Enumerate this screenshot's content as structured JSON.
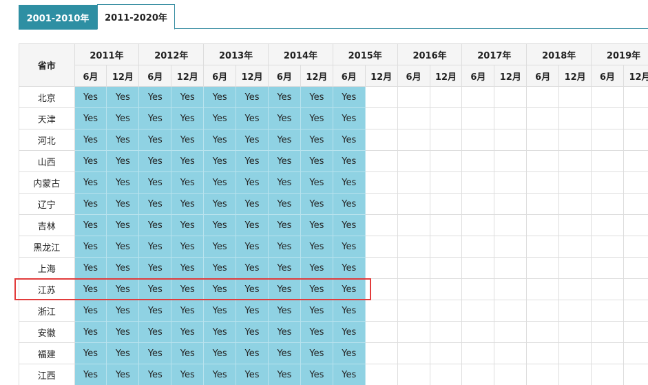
{
  "tabs": [
    "2001-2010年",
    "2011-2020年"
  ],
  "table": {
    "corner_label": "省市",
    "years": [
      "2011年",
      "2012年",
      "2013年",
      "2014年",
      "2015年",
      "2016年",
      "2017年",
      "2018年",
      "2019年"
    ],
    "months": [
      "6月",
      "12月"
    ],
    "rows": [
      {
        "province": "北京",
        "values": [
          "Yes",
          "Yes",
          "Yes",
          "Yes",
          "Yes",
          "Yes",
          "Yes",
          "Yes",
          "Yes"
        ]
      },
      {
        "province": "天津",
        "values": [
          "Yes",
          "Yes",
          "Yes",
          "Yes",
          "Yes",
          "Yes",
          "Yes",
          "Yes",
          "Yes"
        ]
      },
      {
        "province": "河北",
        "values": [
          "Yes",
          "Yes",
          "Yes",
          "Yes",
          "Yes",
          "Yes",
          "Yes",
          "Yes",
          "Yes"
        ]
      },
      {
        "province": "山西",
        "values": [
          "Yes",
          "Yes",
          "Yes",
          "Yes",
          "Yes",
          "Yes",
          "Yes",
          "Yes",
          "Yes"
        ]
      },
      {
        "province": "内蒙古",
        "values": [
          "Yes",
          "Yes",
          "Yes",
          "Yes",
          "Yes",
          "Yes",
          "Yes",
          "Yes",
          "Yes"
        ]
      },
      {
        "province": "辽宁",
        "values": [
          "Yes",
          "Yes",
          "Yes",
          "Yes",
          "Yes",
          "Yes",
          "Yes",
          "Yes",
          "Yes"
        ]
      },
      {
        "province": "吉林",
        "values": [
          "Yes",
          "Yes",
          "Yes",
          "Yes",
          "Yes",
          "Yes",
          "Yes",
          "Yes",
          "Yes"
        ]
      },
      {
        "province": "黑龙江",
        "values": [
          "Yes",
          "Yes",
          "Yes",
          "Yes",
          "Yes",
          "Yes",
          "Yes",
          "Yes",
          "Yes"
        ]
      },
      {
        "province": "上海",
        "values": [
          "Yes",
          "Yes",
          "Yes",
          "Yes",
          "Yes",
          "Yes",
          "Yes",
          "Yes",
          "Yes"
        ]
      },
      {
        "province": "江苏",
        "values": [
          "Yes",
          "Yes",
          "Yes",
          "Yes",
          "Yes",
          "Yes",
          "Yes",
          "Yes",
          "Yes"
        ]
      },
      {
        "province": "浙江",
        "values": [
          "Yes",
          "Yes",
          "Yes",
          "Yes",
          "Yes",
          "Yes",
          "Yes",
          "Yes",
          "Yes"
        ]
      },
      {
        "province": "安徽",
        "values": [
          "Yes",
          "Yes",
          "Yes",
          "Yes",
          "Yes",
          "Yes",
          "Yes",
          "Yes",
          "Yes"
        ]
      },
      {
        "province": "福建",
        "values": [
          "Yes",
          "Yes",
          "Yes",
          "Yes",
          "Yes",
          "Yes",
          "Yes",
          "Yes",
          "Yes"
        ]
      },
      {
        "province": "江西",
        "values": [
          "Yes",
          "Yes",
          "Yes",
          "Yes",
          "Yes",
          "Yes",
          "Yes",
          "Yes",
          "Yes"
        ]
      }
    ]
  },
  "colors": {
    "tab_active_bg": "#2e8fa3",
    "yes_cell_bg": "#8fd2e3",
    "highlight_border": "#e23b3b"
  }
}
